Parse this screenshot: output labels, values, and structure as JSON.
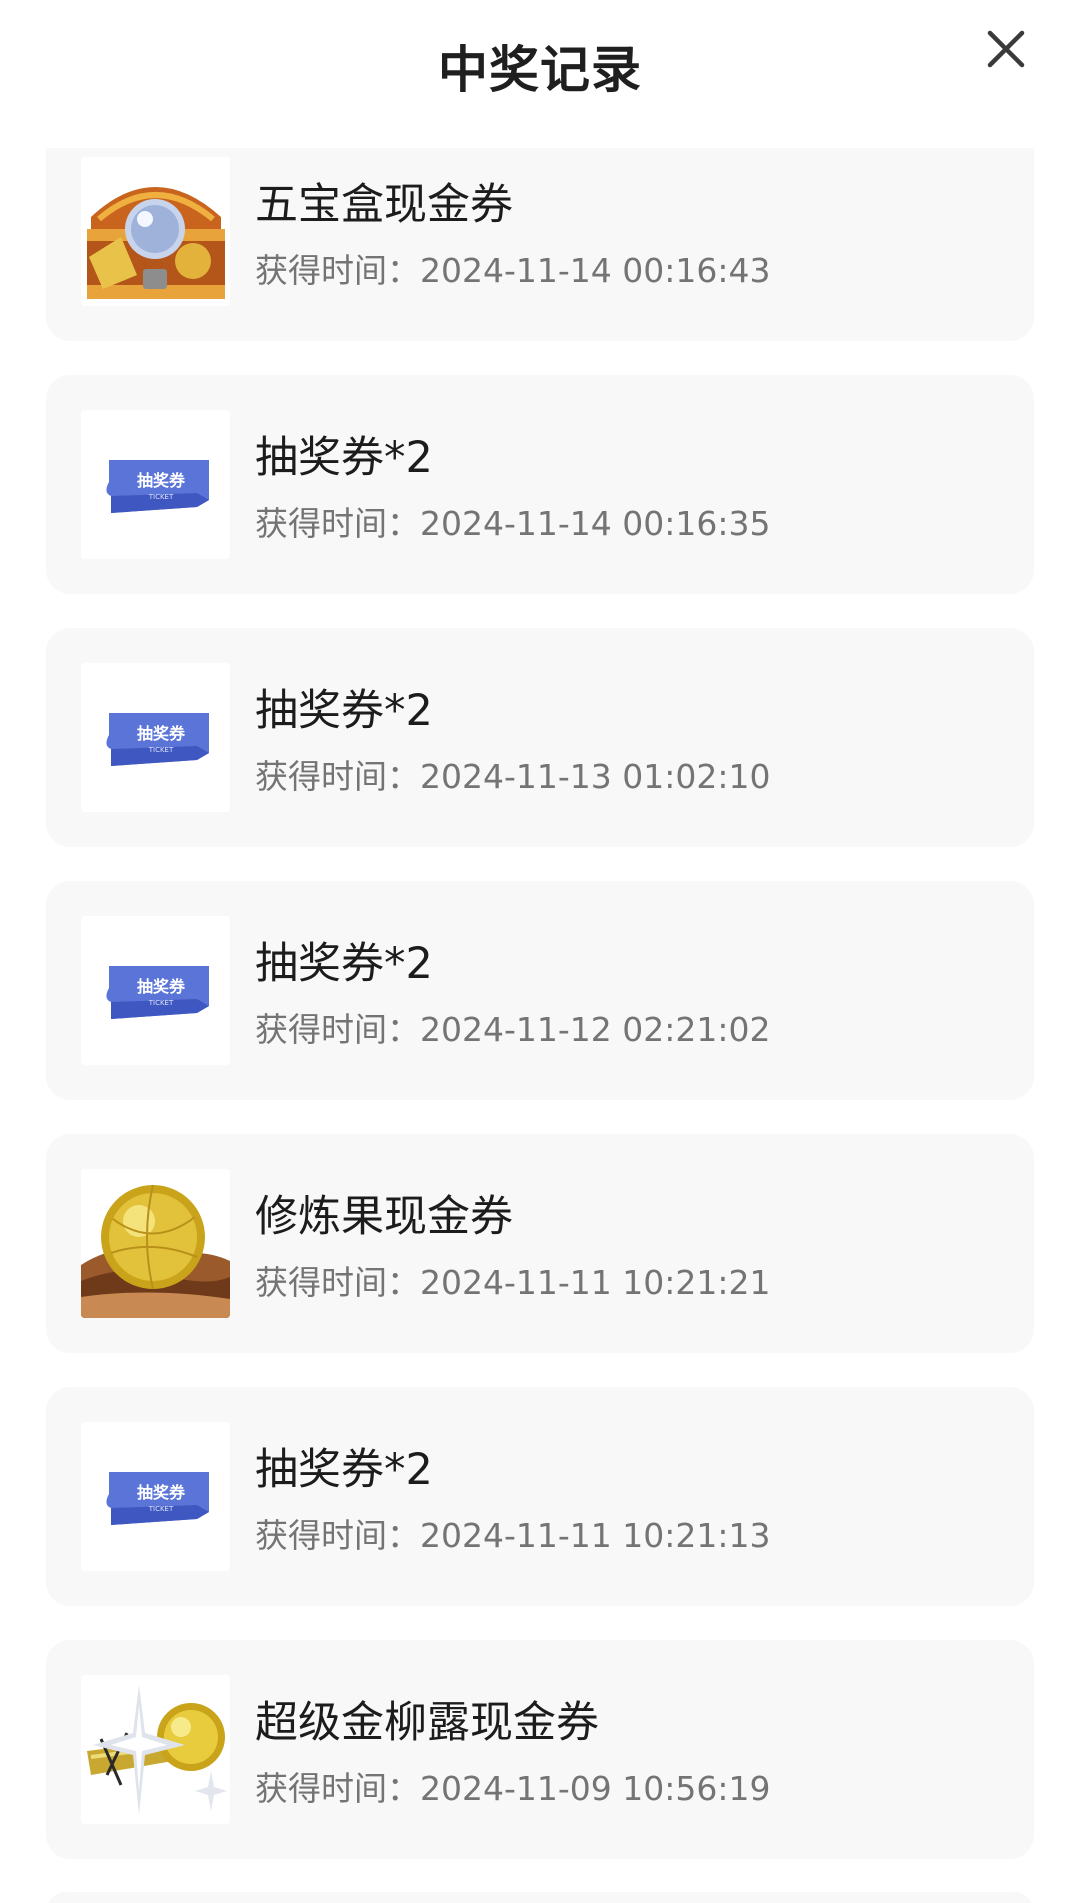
{
  "header": {
    "title": "中奖记录",
    "close_icon": "close-icon"
  },
  "time_label": "获得时间：",
  "colors": {
    "card_bg": "#f8f8f8",
    "title": "#1f1f1f",
    "time_text": "#747474",
    "ticket": "#5b74d8"
  },
  "records": [
    {
      "name": "五宝盒现金券",
      "time": "2024-11-14 00:16:43",
      "icon": "treasure-box-icon"
    },
    {
      "name": "抽奖券*2",
      "time": "2024-11-14 00:16:35",
      "icon": "lottery-ticket-icon",
      "ticket_text": "抽奖券",
      "ticket_sub": "TICKET"
    },
    {
      "name": "抽奖券*2",
      "time": "2024-11-13 01:02:10",
      "icon": "lottery-ticket-icon",
      "ticket_text": "抽奖券",
      "ticket_sub": "TICKET"
    },
    {
      "name": "抽奖券*2",
      "time": "2024-11-12 02:21:02",
      "icon": "lottery-ticket-icon",
      "ticket_text": "抽奖券",
      "ticket_sub": "TICKET"
    },
    {
      "name": "修炼果现金券",
      "time": "2024-11-11 10:21:21",
      "icon": "golden-fruit-icon"
    },
    {
      "name": "抽奖券*2",
      "time": "2024-11-11 10:21:13",
      "icon": "lottery-ticket-icon",
      "ticket_text": "抽奖券",
      "ticket_sub": "TICKET"
    },
    {
      "name": "超级金柳露现金券",
      "time": "2024-11-09 10:56:19",
      "icon": "golden-elixir-icon"
    }
  ]
}
